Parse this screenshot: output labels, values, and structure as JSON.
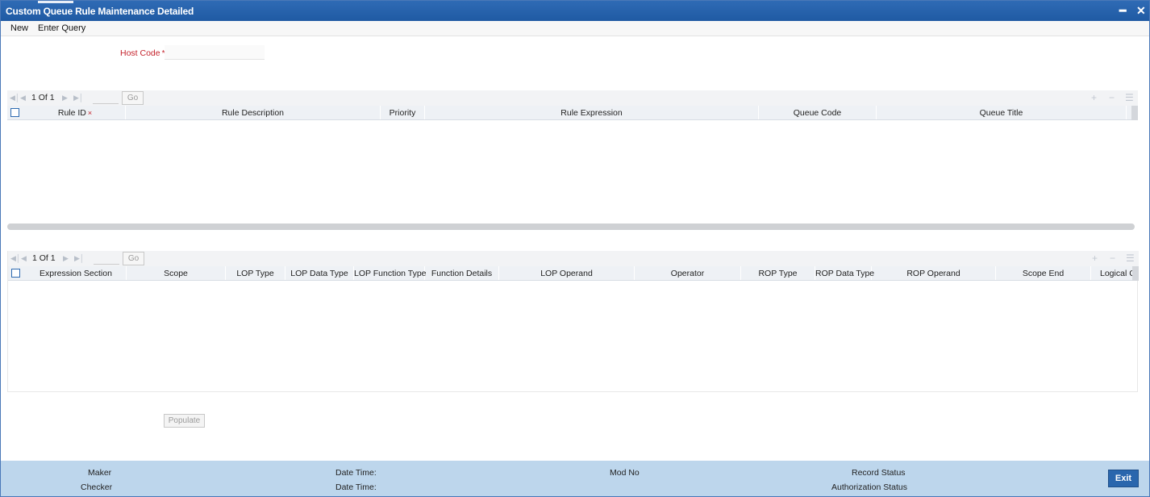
{
  "window": {
    "title": "Custom Queue Rule Maintenance Detailed",
    "minimize_icon": "minimize-icon",
    "close_icon": "close-icon"
  },
  "menu": {
    "new_label": "New",
    "enter_query_label": "Enter Query"
  },
  "form": {
    "host_code_label": "Host Code",
    "required_marker": "*",
    "host_code_value": ""
  },
  "rules_grid": {
    "page_info": "1 Of 1",
    "go_label": "Go",
    "columns": [
      "Rule ID",
      "Rule Description",
      "Priority",
      "Rule Expression",
      "Queue Code",
      "Queue Title"
    ],
    "required_marker": "×",
    "rows": []
  },
  "expression_grid": {
    "page_info": "1 Of 1",
    "go_label": "Go",
    "columns": [
      "Expression Section",
      "Scope",
      "LOP Type",
      "LOP Data Type",
      "LOP Function Type",
      "Function Details",
      "LOP Operand",
      "Operator",
      "ROP Type",
      "ROP Data Type",
      "ROP Operand",
      "Scope End",
      "Logical C"
    ],
    "rows": []
  },
  "populate_label": "Populate",
  "footer": {
    "maker_label": "Maker",
    "checker_label": "Checker",
    "date_time_label_1": "Date Time:",
    "date_time_label_2": "Date Time:",
    "mod_no_label": "Mod No",
    "record_status_label": "Record Status",
    "authorization_status_label": "Authorization Status",
    "exit_label": "Exit"
  },
  "colors": {
    "titlebar": "#1f5aa3",
    "required": "#c4222b",
    "footer": "#bdd6ec",
    "exit_button": "#2a66ad"
  }
}
